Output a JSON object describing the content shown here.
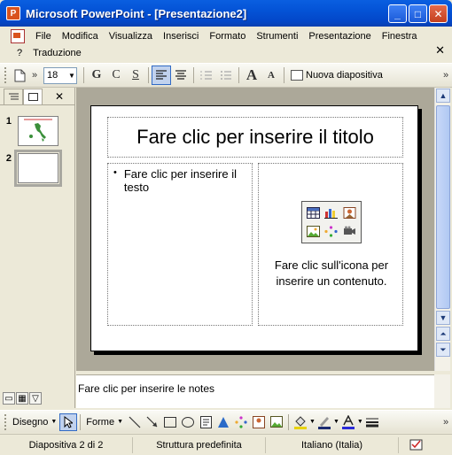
{
  "window": {
    "app_icon": "P",
    "title": "Microsoft PowerPoint - [Presentazione2]",
    "minimize_glyph": "_",
    "maximize_glyph": "□",
    "close_glyph": "✕"
  },
  "menu": {
    "items": [
      "File",
      "Modifica",
      "Visualizza",
      "Inserisci",
      "Formato",
      "Strumenti",
      "Presentazione",
      "Finestra"
    ],
    "help": "?",
    "translation": "Traduzione",
    "close_glyph": "✕"
  },
  "toolbar": {
    "font_size": "18",
    "bold": "G",
    "italic": "C",
    "shadow": "S",
    "increase_font": "A",
    "decrease_font": "A",
    "new_slide": "Nuova diapositiva",
    "more": "»"
  },
  "left_pane": {
    "close_glyph": "✕",
    "slides": [
      {
        "number": "1"
      },
      {
        "number": "2"
      }
    ]
  },
  "slide": {
    "title_placeholder": "Fare clic per inserire il titolo",
    "text_placeholder": "Fare clic per inserire il testo",
    "content_placeholder": "Fare clic sull'icona per inserire un contenuto."
  },
  "notes": {
    "placeholder": "Fare clic per inserire le notes"
  },
  "drawing": {
    "draw_menu": "Disegno",
    "shapes_menu": "Forme"
  },
  "status": {
    "slide_count": "Diapositiva 2 di 2",
    "design": "Struttura predefinita",
    "language": "Italiano (Italia)"
  },
  "colors": {
    "titlebar": "#0453d6",
    "workspace": "#aca899",
    "chrome": "#ece9d8"
  }
}
